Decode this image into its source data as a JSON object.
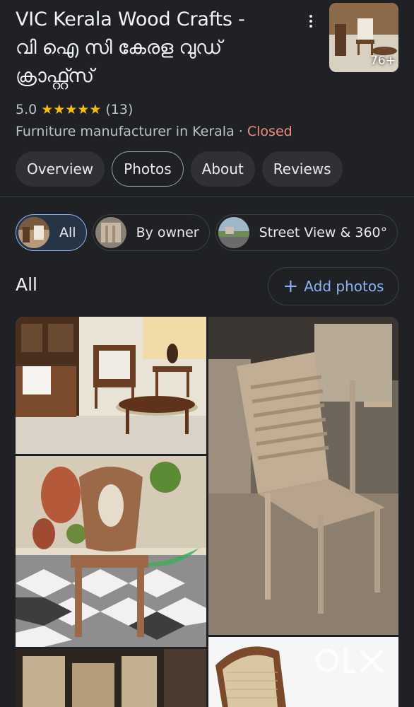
{
  "place": {
    "title_en": "VIC Kerala Wood Crafts -",
    "title_ml_1": "വി ഐ സി കേരള വുഡ്",
    "title_ml_2": "ക്രാഫ്റ്റ്സ്",
    "rating": "5.0",
    "stars": "★★★★★",
    "review_count": "(13)",
    "category": "Furniture manufacturer in Kerala",
    "separator": "·",
    "status": "Closed",
    "photo_count": "76+"
  },
  "tabs": [
    {
      "label": "Overview",
      "active": false
    },
    {
      "label": "Photos",
      "active": true
    },
    {
      "label": "About",
      "active": false
    },
    {
      "label": "Reviews",
      "active": false
    }
  ],
  "chips": [
    {
      "label": "All",
      "active": true
    },
    {
      "label": "By owner",
      "active": false
    },
    {
      "label": "Street View & 360°",
      "active": false
    }
  ],
  "section": {
    "title": "All",
    "add_label": "Add photos",
    "add_icon": "plus-icon"
  },
  "photos": [
    {
      "name": "living-room-furniture"
    },
    {
      "name": "workshop-chair-frame"
    },
    {
      "name": "carved-chair-frame"
    },
    {
      "name": "wood-panels"
    },
    {
      "name": "cane-chair"
    }
  ],
  "watermark": "OLX",
  "colors": {
    "background": "#1f2125",
    "accent": "#8ab4f8",
    "star": "#fbbc04",
    "closed": "#f28b82"
  }
}
